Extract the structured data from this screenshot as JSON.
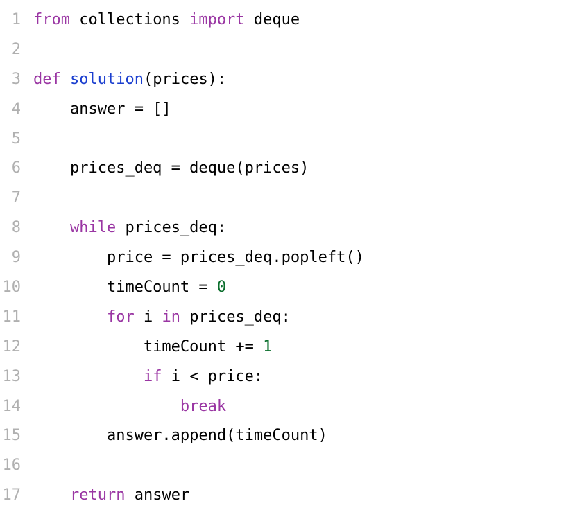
{
  "code": {
    "lines": [
      {
        "num": "1",
        "tokens": [
          {
            "cls": "kw",
            "t": "from"
          },
          {
            "cls": "txt",
            "t": " collections "
          },
          {
            "cls": "kw",
            "t": "import"
          },
          {
            "cls": "txt",
            "t": " deque"
          }
        ]
      },
      {
        "num": "2",
        "tokens": []
      },
      {
        "num": "3",
        "tokens": [
          {
            "cls": "kw",
            "t": "def"
          },
          {
            "cls": "txt",
            "t": " "
          },
          {
            "cls": "fn",
            "t": "solution"
          },
          {
            "cls": "txt",
            "t": "(prices):"
          }
        ]
      },
      {
        "num": "4",
        "tokens": [
          {
            "cls": "txt",
            "t": "    answer = []"
          }
        ]
      },
      {
        "num": "5",
        "tokens": []
      },
      {
        "num": "6",
        "tokens": [
          {
            "cls": "txt",
            "t": "    prices_deq = deque(prices)"
          }
        ]
      },
      {
        "num": "7",
        "tokens": []
      },
      {
        "num": "8",
        "tokens": [
          {
            "cls": "txt",
            "t": "    "
          },
          {
            "cls": "kw",
            "t": "while"
          },
          {
            "cls": "txt",
            "t": " prices_deq:"
          }
        ]
      },
      {
        "num": "9",
        "tokens": [
          {
            "cls": "txt",
            "t": "        price = prices_deq.popleft()"
          }
        ]
      },
      {
        "num": "10",
        "tokens": [
          {
            "cls": "txt",
            "t": "        timeCount = "
          },
          {
            "cls": "num",
            "t": "0"
          }
        ]
      },
      {
        "num": "11",
        "tokens": [
          {
            "cls": "txt",
            "t": "        "
          },
          {
            "cls": "kw",
            "t": "for"
          },
          {
            "cls": "txt",
            "t": " i "
          },
          {
            "cls": "kw",
            "t": "in"
          },
          {
            "cls": "txt",
            "t": " prices_deq:"
          }
        ]
      },
      {
        "num": "12",
        "tokens": [
          {
            "cls": "txt",
            "t": "            timeCount += "
          },
          {
            "cls": "num",
            "t": "1"
          }
        ]
      },
      {
        "num": "13",
        "tokens": [
          {
            "cls": "txt",
            "t": "            "
          },
          {
            "cls": "kw",
            "t": "if"
          },
          {
            "cls": "txt",
            "t": " i < price:"
          }
        ]
      },
      {
        "num": "14",
        "tokens": [
          {
            "cls": "txt",
            "t": "                "
          },
          {
            "cls": "kw",
            "t": "break"
          }
        ]
      },
      {
        "num": "15",
        "tokens": [
          {
            "cls": "txt",
            "t": "        answer.append(timeCount)"
          }
        ]
      },
      {
        "num": "16",
        "tokens": []
      },
      {
        "num": "17",
        "tokens": [
          {
            "cls": "txt",
            "t": "    "
          },
          {
            "cls": "kw",
            "t": "return"
          },
          {
            "cls": "txt",
            "t": " answer"
          }
        ]
      }
    ]
  }
}
